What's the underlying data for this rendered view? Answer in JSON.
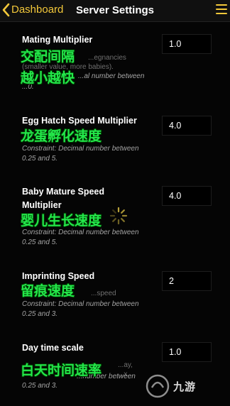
{
  "nav": {
    "back_label": "Dashboard",
    "title": "Server Settings"
  },
  "settings": [
    {
      "name": "Mating Multiplier",
      "desc_line1": "...egnancies",
      "desc_line2": "(smaller value, more babies).",
      "constraint_line1": "...al number between",
      "constraint_line2": "...0.",
      "value": "1.0",
      "overlay_line1": "交配间隔",
      "overlay_line2": "越小越快"
    },
    {
      "name": "Egg Hatch Speed Multiplier",
      "constraint_line1": "Constraint: Decimal number between",
      "constraint_line2": "0.25 and 5.",
      "value": "4.0",
      "overlay_line1": "龙蛋孵化速度"
    },
    {
      "name_line1": "Baby Mature Speed",
      "name_line2": "Multiplier",
      "constraint_line1": "Constraint: Decimal number between",
      "constraint_line2": "0.25 and 5.",
      "value": "4.0",
      "overlay_line1": "婴儿生长速度"
    },
    {
      "name": "Imprinting Speed",
      "desc_line1": "...speed",
      "constraint_line1": "Constraint: Decimal number between",
      "constraint_line2": "0.25 and 3.",
      "value": "2",
      "overlay_line1": "留痕速度"
    },
    {
      "name": "Day time scale",
      "desc_line1": "...ay,",
      "desc_line2": "...x,",
      "constraint_line1": "...number between",
      "constraint_line2": "0.25 and 3.",
      "value": "1.0",
      "overlay_line1": "白天时间速率"
    }
  ],
  "watermark": {
    "text": "九游"
  },
  "colors": {
    "accent": "#f3c83a",
    "overlay_green": "#23e84a",
    "background": "#050505"
  },
  "icons": {
    "back": "chevron-left-icon",
    "menu": "hamburger-menu-icon",
    "spinner": "loading-spinner-icon"
  }
}
